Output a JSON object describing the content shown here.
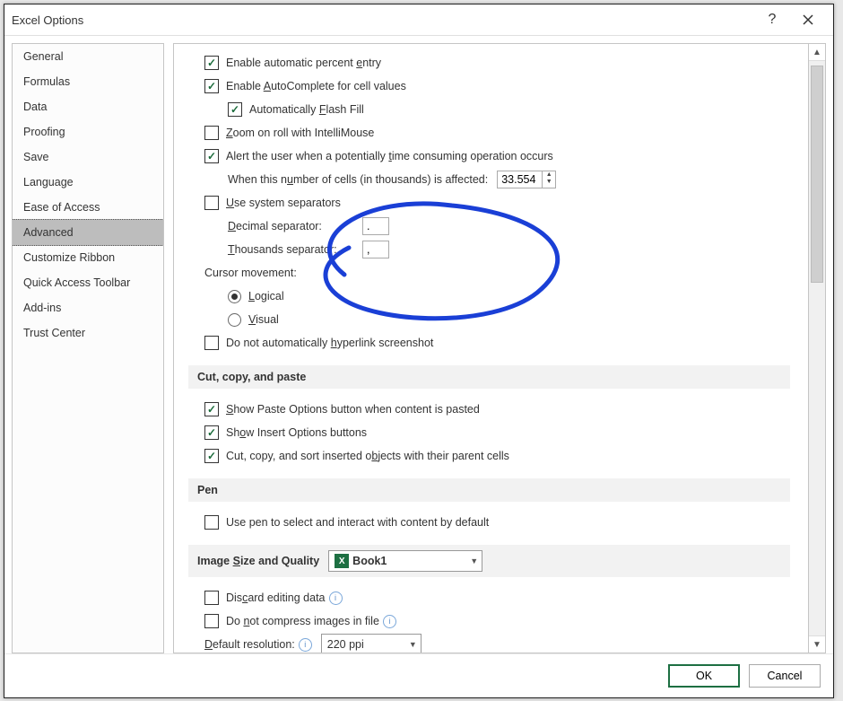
{
  "title": "Excel Options",
  "sidebar": {
    "items": [
      {
        "label": "General"
      },
      {
        "label": "Formulas"
      },
      {
        "label": "Data"
      },
      {
        "label": "Proofing"
      },
      {
        "label": "Save"
      },
      {
        "label": "Language"
      },
      {
        "label": "Ease of Access"
      },
      {
        "label": "Advanced",
        "selected": true
      },
      {
        "label": "Customize Ribbon"
      },
      {
        "label": "Quick Access Toolbar"
      },
      {
        "label": "Add-ins"
      },
      {
        "label": "Trust Center"
      }
    ]
  },
  "editing": {
    "auto_percent": "Enable automatic percent entry",
    "autocomplete": "Enable AutoComplete for cell values",
    "flash_fill": "Automatically Flash Fill",
    "zoom_intellimouse": "Zoom on roll with IntelliMouse",
    "alert_time": "Alert the user when a potentially time consuming operation occurs",
    "cells_label": "When this number of cells (in thousands) is affected:",
    "cells_value": "33.554",
    "use_sys_sep": "Use system separators",
    "dec_sep_label": "Decimal separator:",
    "dec_sep_value": ".",
    "thou_sep_label": "Thousands separator:",
    "thou_sep_value": ",",
    "cursor_label": "Cursor movement:",
    "cursor_logical": "Logical",
    "cursor_visual": "Visual",
    "no_auto_hyperlink": "Do not automatically hyperlink screenshot"
  },
  "ccp": {
    "header": "Cut, copy, and paste",
    "paste_options": "Show Paste Options button when content is pasted",
    "insert_options": "Show Insert Options buttons",
    "cut_copy_sort": "Cut, copy, and sort inserted objects with their parent cells"
  },
  "pen": {
    "header": "Pen",
    "use_pen": "Use pen to select and interact with content by default"
  },
  "image": {
    "header": "Image Size and Quality",
    "workbook": "Book1",
    "discard": "Discard editing data",
    "no_compress": "Do not compress images in file",
    "default_res_label": "Default resolution:",
    "default_res_value": "220 ppi"
  },
  "buttons": {
    "ok": "OK",
    "cancel": "Cancel"
  }
}
